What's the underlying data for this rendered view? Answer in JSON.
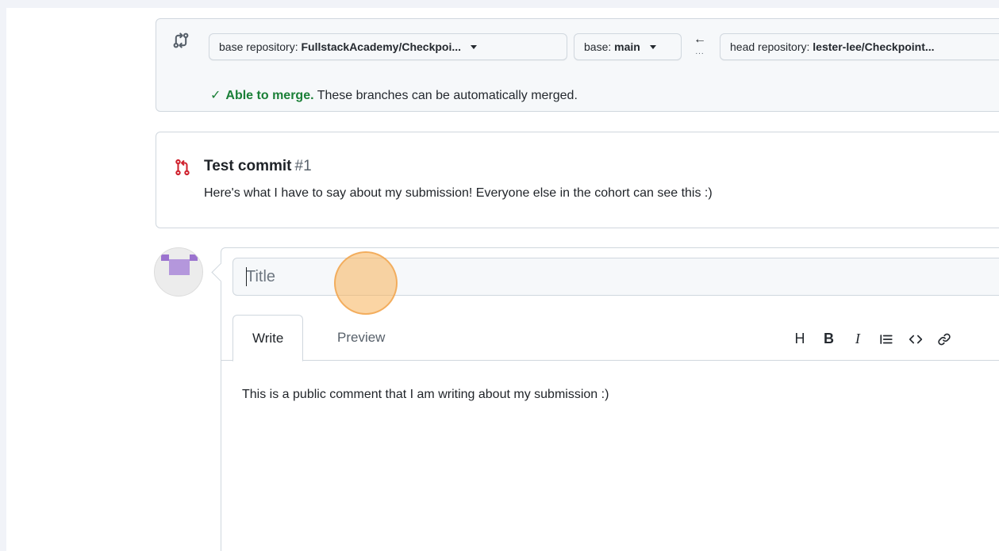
{
  "compare": {
    "icon": "git-compare-icon",
    "base_repository_label": "base repository:",
    "base_repository_value": "FullstackAcademy/Checkpoi...",
    "base_label": "base:",
    "base_value": "main",
    "arrow": "←",
    "arrow_dots": "...",
    "head_repository_label": "head repository:",
    "head_repository_value": "lester-lee/Checkpoint...",
    "merge_check": "✓",
    "merge_status": "Able to merge.",
    "merge_message": "These branches can be automatically merged."
  },
  "commit": {
    "icon": "git-pull-request-icon",
    "title": "Test commit",
    "number": "#1",
    "body": "Here's what I have to say about my submission! Everyone else in the cohort can see this :)"
  },
  "comment_form": {
    "title_placeholder": "Title",
    "tabs": [
      {
        "label": "Write",
        "active": true
      },
      {
        "label": "Preview",
        "active": false
      }
    ],
    "toolbar": {
      "heading": "H",
      "bold": "B",
      "italic": "I"
    },
    "body_text": "This is a public comment that I am writing about my submission :)"
  },
  "colors": {
    "success": "#1a7f37",
    "pr_icon": "#cf222e",
    "click_marker": "#f7b25a"
  }
}
